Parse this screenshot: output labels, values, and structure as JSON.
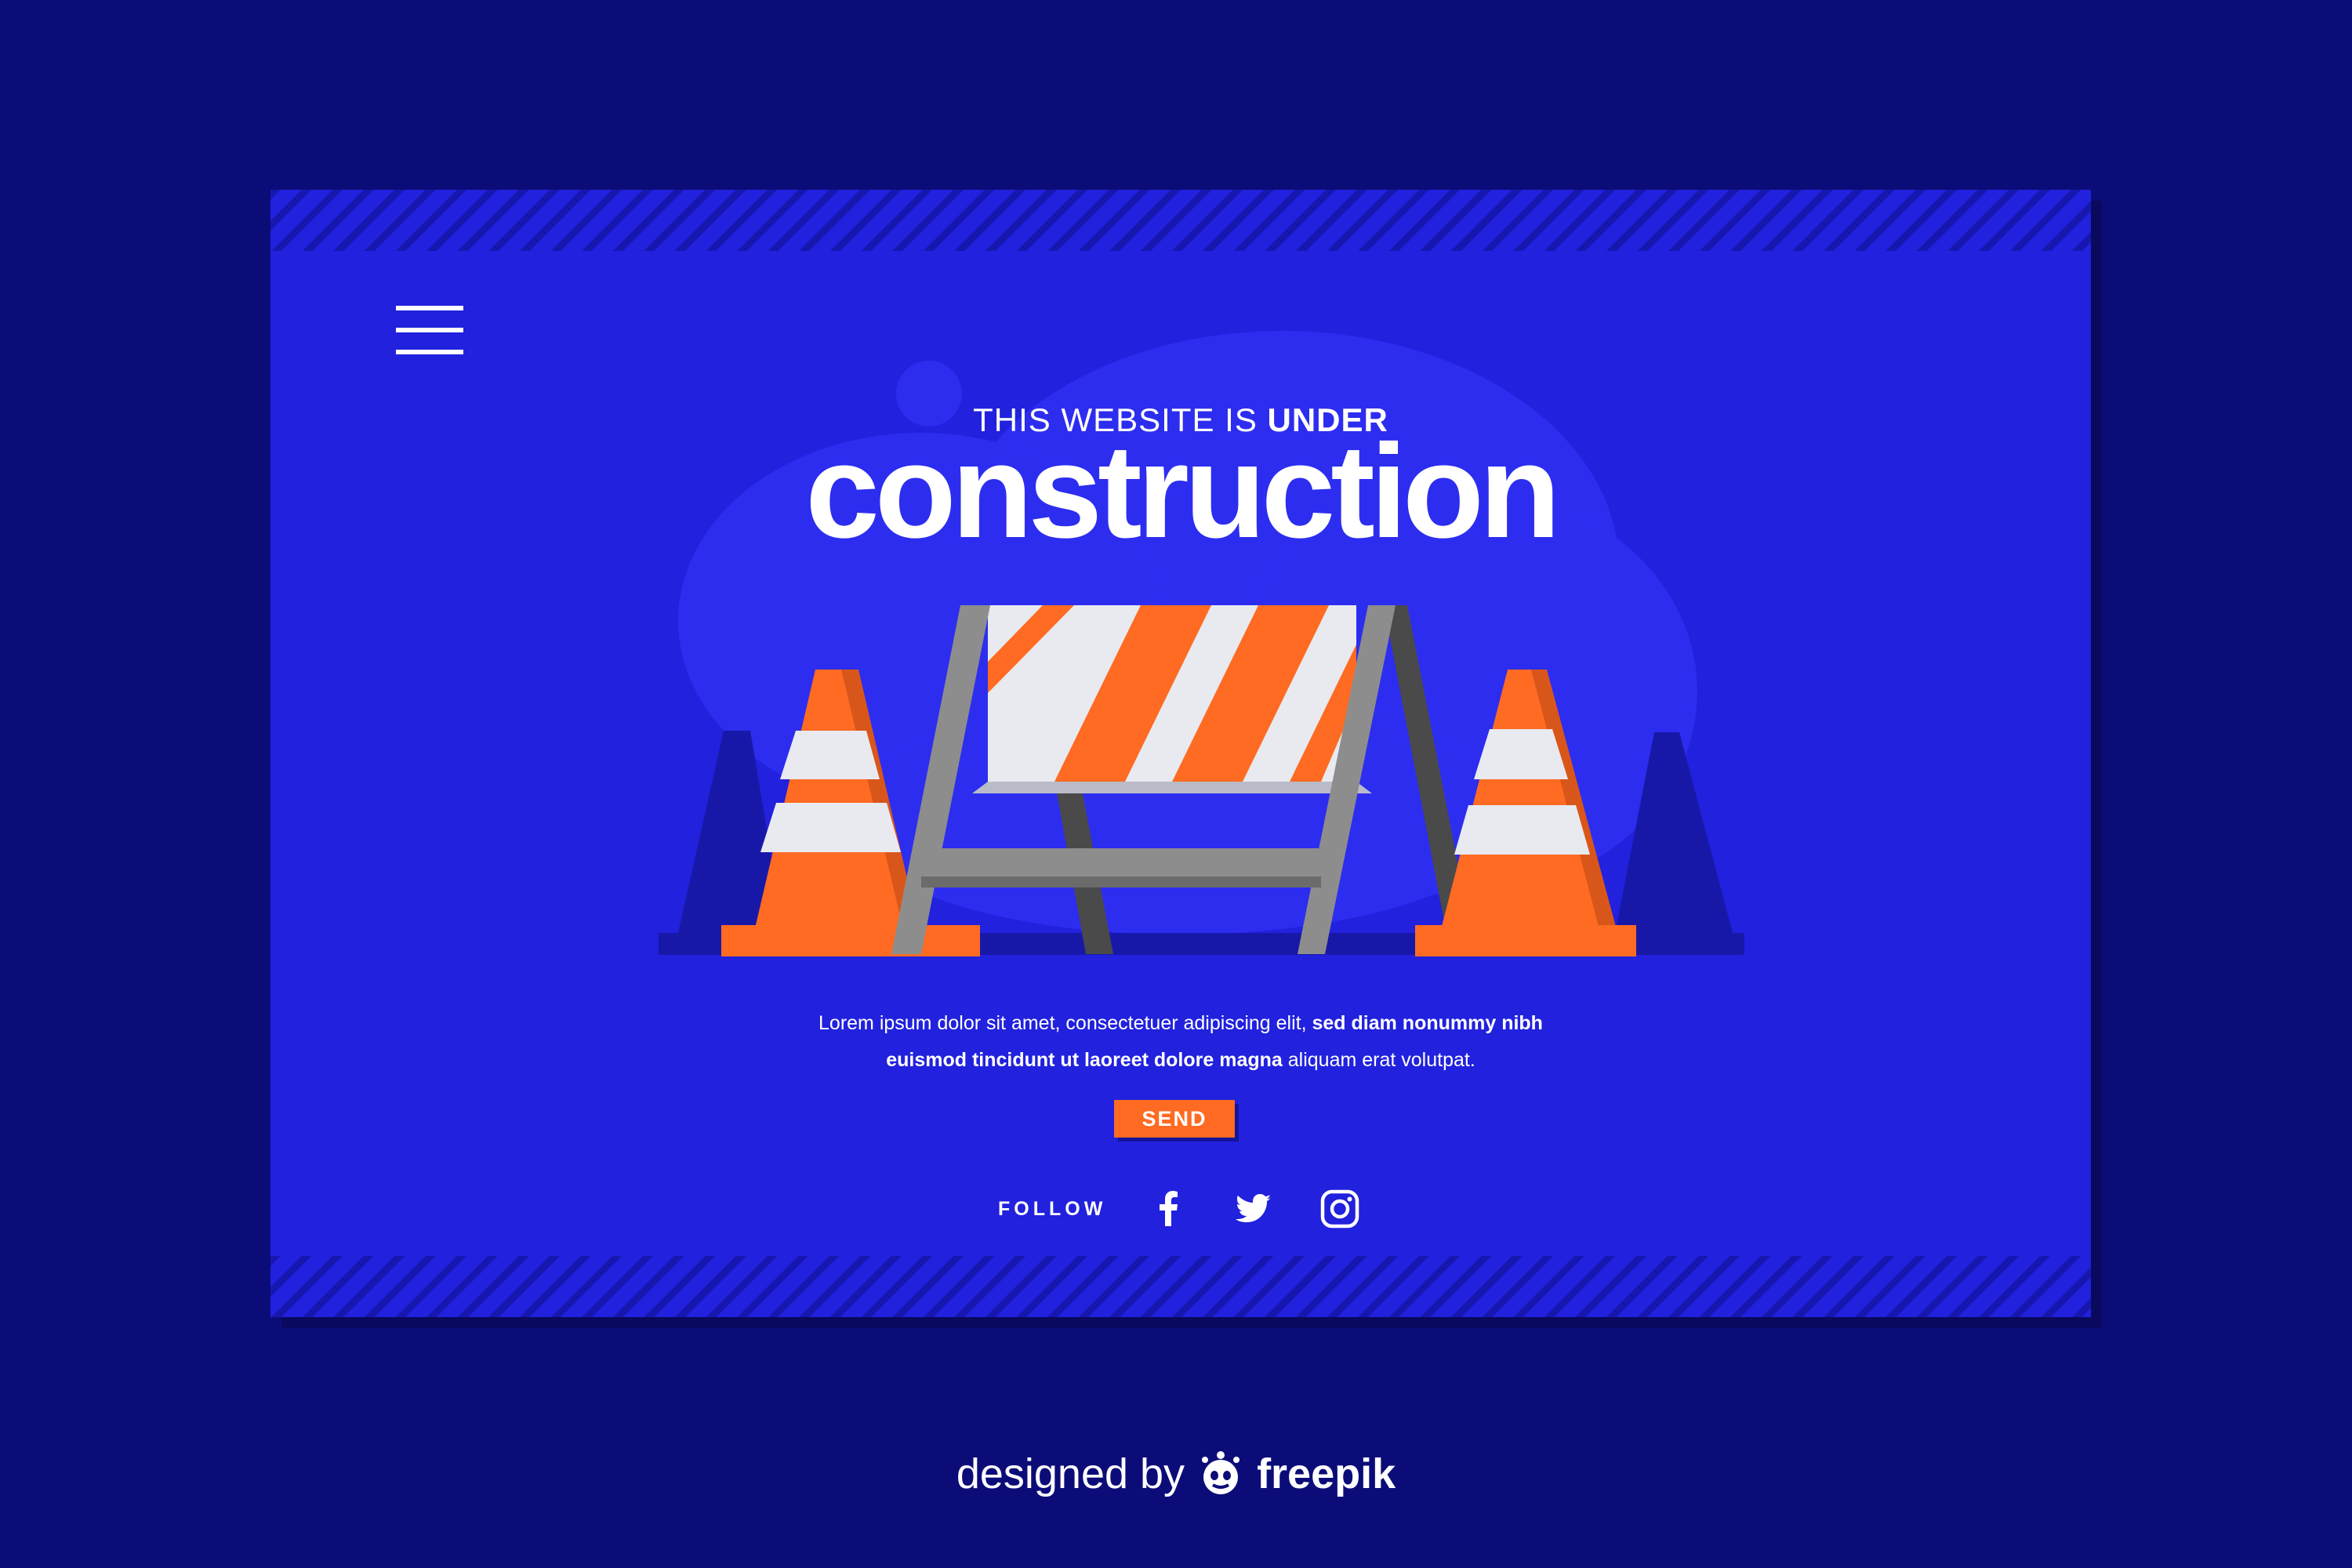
{
  "hero": {
    "heading_line1": "THIS WEBSITE IS",
    "heading_line1_bold": "UNDER",
    "heading_main": "construction"
  },
  "body": {
    "part1": "Lorem ipsum dolor sit amet, consectetuer adipiscing elit, ",
    "part2_bold": "sed diam nonummy nibh",
    "part3_bold": "euismod tincidunt ut laoreet dolore magna",
    "part4": " aliquam erat volutpat."
  },
  "cta": {
    "send_label": "SEND"
  },
  "social": {
    "follow_label": "FOLLOW",
    "icons": [
      "facebook-icon",
      "twitter-icon",
      "instagram-icon"
    ]
  },
  "credit": {
    "prefix": "designed by",
    "brand": "freepik"
  },
  "colors": {
    "page_background": "#0c0c78",
    "card_background": "#2121de",
    "accent_orange": "#ff6b22",
    "text": "#ffffff"
  }
}
